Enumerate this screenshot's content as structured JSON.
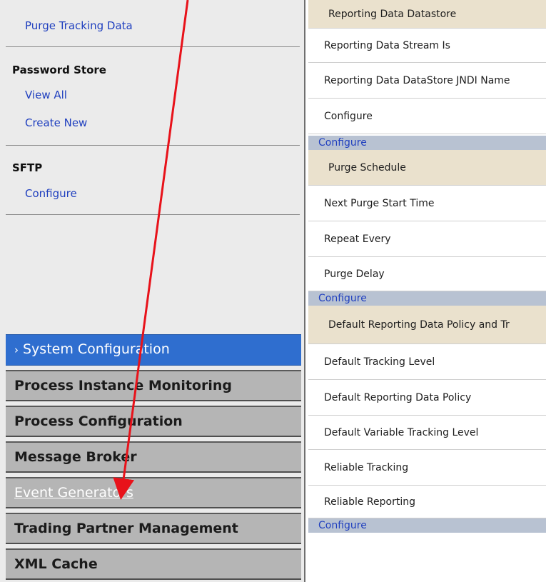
{
  "left_nav": {
    "purge_tracking_link": "Purge Tracking Data",
    "password_store": {
      "title": "Password Store",
      "view_all": "View All",
      "create_new": "Create New"
    },
    "sftp": {
      "title": "SFTP",
      "configure": "Configure"
    },
    "sections": [
      {
        "label": "System Configuration",
        "state": "active"
      },
      {
        "label": "Process Instance Monitoring",
        "state": "normal"
      },
      {
        "label": "Process Configuration",
        "state": "normal"
      },
      {
        "label": "Message Broker",
        "state": "normal"
      },
      {
        "label": "Event Generators",
        "state": "hovered-link"
      },
      {
        "label": "Trading Partner Management",
        "state": "normal"
      },
      {
        "label": "XML Cache",
        "state": "normal"
      }
    ]
  },
  "right_table": {
    "rows": [
      {
        "text": "Reporting Data Datastore",
        "kind": "header"
      },
      {
        "text": "Reporting Data Stream Is",
        "kind": "row"
      },
      {
        "text": "Reporting Data DataStore JNDI Name",
        "kind": "row"
      },
      {
        "text": "Configure",
        "kind": "row"
      },
      {
        "text": "Configure",
        "kind": "configure-link"
      },
      {
        "text": "Purge Schedule",
        "kind": "header"
      },
      {
        "text": "Next Purge Start Time",
        "kind": "row"
      },
      {
        "text": "Repeat Every",
        "kind": "row"
      },
      {
        "text": "Purge Delay",
        "kind": "row"
      },
      {
        "text": "Configure",
        "kind": "configure-link"
      },
      {
        "text": "Default Reporting Data Policy and Tr",
        "kind": "header"
      },
      {
        "text": "Default Tracking Level",
        "kind": "row"
      },
      {
        "text": "Default Reporting Data Policy",
        "kind": "row"
      },
      {
        "text": "Default Variable Tracking Level",
        "kind": "row"
      },
      {
        "text": "Reliable Tracking",
        "kind": "row"
      },
      {
        "text": "Reliable Reporting",
        "kind": "row"
      },
      {
        "text": "Configure",
        "kind": "configure-link"
      }
    ]
  },
  "colors": {
    "active_section": "#2f6ecf",
    "section_bg": "#b5b5b5",
    "link": "#1f3fbf",
    "configure_bar": "#b8c2d2",
    "header_row": "#eae1cd",
    "annotation_arrow": "#e8121a"
  }
}
